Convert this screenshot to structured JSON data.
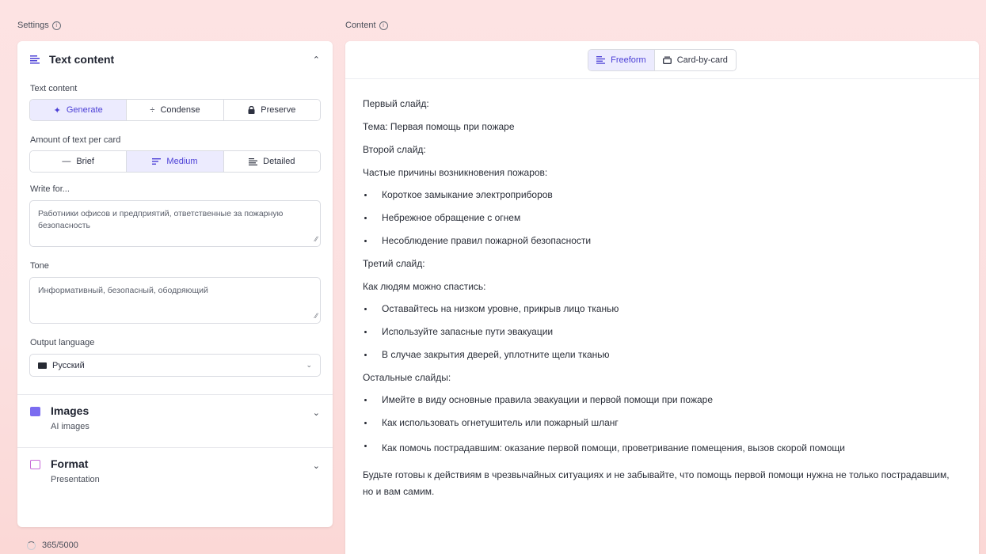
{
  "labels": {
    "settings": "Settings",
    "content": "Content"
  },
  "settings": {
    "text_content_section": {
      "title": "Text content",
      "text_content_label": "Text content",
      "text_modes": [
        {
          "label": "Generate",
          "icon": "sparkle-icon",
          "active": true
        },
        {
          "label": "Condense",
          "icon": "condense-icon",
          "active": false
        },
        {
          "label": "Preserve",
          "icon": "lock-icon",
          "active": false
        }
      ],
      "amount_label": "Amount of text per card",
      "amounts": [
        {
          "label": "Brief",
          "icon": "dash-icon",
          "active": false
        },
        {
          "label": "Medium",
          "icon": "lines-icon",
          "active": true
        },
        {
          "label": "Detailed",
          "icon": "detailed-lines-icon",
          "active": false
        }
      ],
      "write_for_label": "Write for...",
      "write_for_value": "Работники офисов и предприятий, ответственные за пожарную безопасность",
      "tone_label": "Tone",
      "tone_value": "Информативный, безопасный, ободряющий",
      "language_label": "Output language",
      "language_value": "Русский"
    },
    "images": {
      "title": "Images",
      "subtitle": "AI images"
    },
    "format": {
      "title": "Format",
      "subtitle": "Presentation"
    },
    "counter": "365/5000"
  },
  "content": {
    "tabs": [
      {
        "label": "Freeform",
        "active": true
      },
      {
        "label": "Card-by-card",
        "active": false
      }
    ],
    "p1": "Первый слайд:",
    "p2": "Тема: Первая помощь при пожаре",
    "p3": "Второй слайд:",
    "p4": "Частые причины возникновения пожаров:",
    "list1": [
      "Короткое замыкание электроприборов",
      "Небрежное обращение с огнем",
      "Несоблюдение правил пожарной безопасности"
    ],
    "p5": "Третий слайд:",
    "p6": "Как людям можно спастись:",
    "list2": [
      "Оставайтесь на низком уровне, прикрыв лицо тканью",
      "Используйте запасные пути эвакуации",
      "В случае закрытия дверей, уплотните щели тканью"
    ],
    "p7": "Остальные слайды:",
    "list3": [
      "Имейте в виду основные правила эвакуации и первой помощи при пожаре",
      "Как использовать огнетушитель или пожарный шланг",
      "Как помочь пострадавшим: оказание первой помощи, проветривание помещения, вызов скорой помощи"
    ],
    "p8": "Будьте готовы к действиям в чрезвычайных ситуациях и не забывайте, что помощь первой помощи нужна не только пострадавшим, но и вам самим."
  },
  "colors": {
    "accent": "#4b3fd6",
    "accent_bg": "#ecebfe",
    "background": "#fde3e3"
  }
}
